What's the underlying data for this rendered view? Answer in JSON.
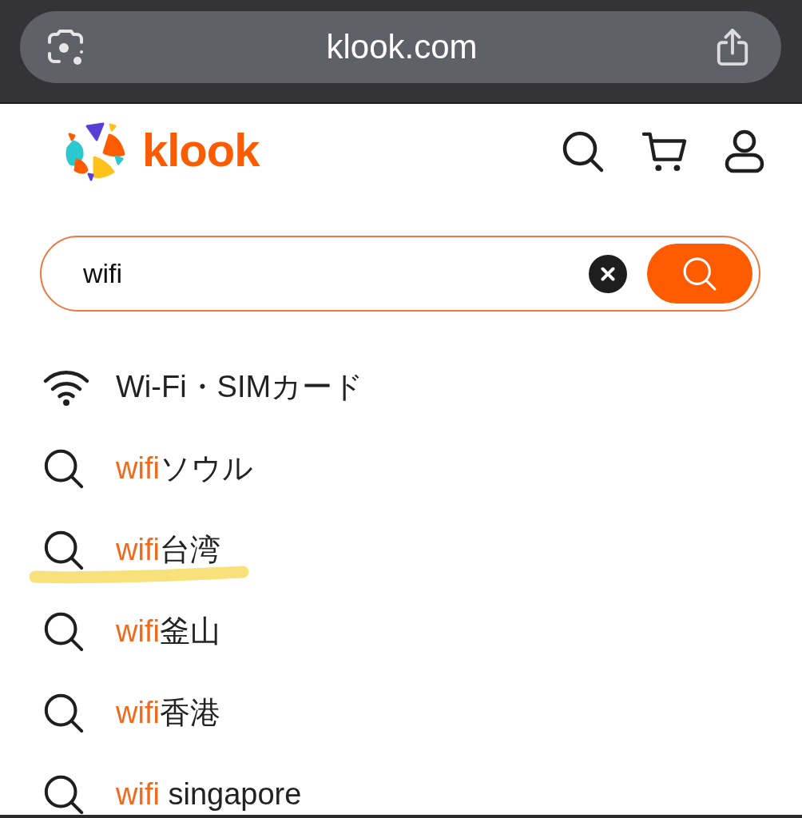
{
  "browser": {
    "url": "klook.com"
  },
  "header": {
    "brand": "klook"
  },
  "search": {
    "value": "wifi"
  },
  "suggestions": [
    {
      "kind": "category",
      "label": "Wi-Fi・SIMカード",
      "underlined": false
    },
    {
      "kind": "query",
      "match": "wifi",
      "rest": "ソウル",
      "underlined": false
    },
    {
      "kind": "query",
      "match": "wifi",
      "rest": "台湾",
      "underlined": true
    },
    {
      "kind": "query",
      "match": "wifi",
      "rest": "釜山",
      "underlined": false
    },
    {
      "kind": "query",
      "match": "wifi",
      "rest": "香港",
      "underlined": false
    },
    {
      "kind": "query",
      "match": "wifi",
      "rest": " singapore",
      "underlined": false
    }
  ]
}
